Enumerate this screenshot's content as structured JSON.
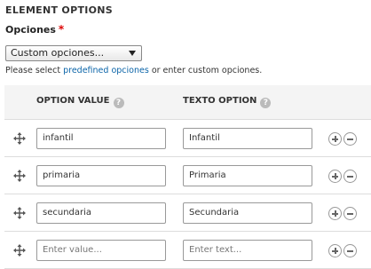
{
  "section": {
    "title": "ELEMENT OPTIONS"
  },
  "options_field": {
    "label": "Opciones",
    "required_mark": "*",
    "selected_value": "Custom opciones..."
  },
  "help": {
    "prefix": "Please select ",
    "link_text": "predefined opciones",
    "suffix": " or enter custom opciones."
  },
  "table": {
    "headers": {
      "value": "OPTION VALUE",
      "text": "TEXTO OPTION",
      "help_glyph": "?"
    },
    "rows": [
      {
        "value": "infantil",
        "text": "Infantil"
      },
      {
        "value": "primaria",
        "text": "Primaria"
      },
      {
        "value": "secundaria",
        "text": "Secundaria"
      }
    ],
    "blank_row": {
      "value_placeholder": "Enter value...",
      "text_placeholder": "Enter text..."
    }
  },
  "icons": {
    "drag": "move-arrows-icon",
    "add": "add-circle-icon",
    "remove": "remove-circle-icon"
  }
}
